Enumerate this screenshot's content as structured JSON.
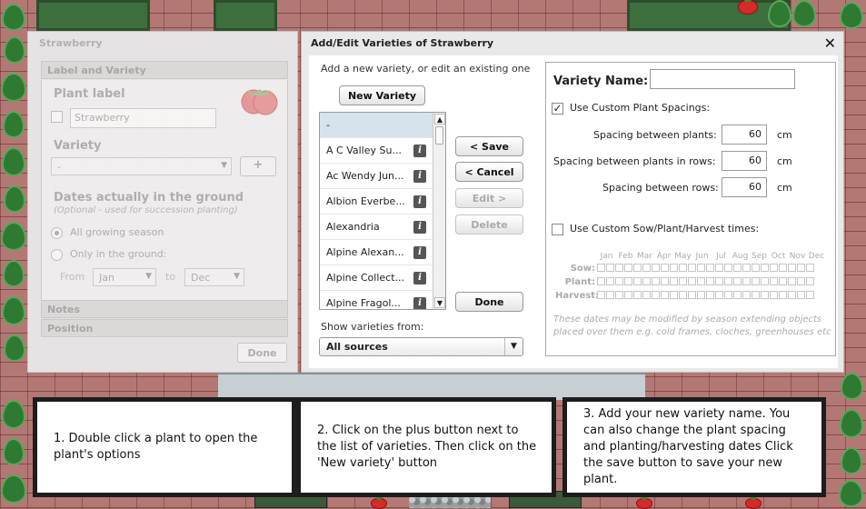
{
  "left_panel": {
    "title": "Strawberry",
    "sections": {
      "label_and_variety": "Label and Variety",
      "notes": "Notes",
      "position": "Position"
    },
    "plant_label_heading": "Plant label",
    "plant_label_value": "Strawberry",
    "variety_heading": "Variety",
    "variety_value": "-",
    "add_button": "+",
    "dates_heading": "Dates actually in the ground",
    "dates_hint": "(Optional - used for succession planting)",
    "radio_all_season": "All growing season",
    "radio_only_ground": "Only in the ground:",
    "from_label": "From",
    "from_value": "Jan",
    "to_label": "to",
    "to_value": "Dec",
    "done_button": "Done"
  },
  "dialog": {
    "title": "Add/Edit Varieties of Strawberry",
    "close_glyph": "✕",
    "hint": "Add a new variety, or edit an existing one",
    "new_variety_button": "New Variety",
    "varieties": [
      {
        "name": "-",
        "selected": true
      },
      {
        "name": "A C Valley Su..."
      },
      {
        "name": "Ac Wendy Jun..."
      },
      {
        "name": "Albion Everbe..."
      },
      {
        "name": "Alexandria"
      },
      {
        "name": "Alpine Alexan..."
      },
      {
        "name": "Alpine Collect..."
      },
      {
        "name": "Alpine Fragol..."
      }
    ],
    "info_glyph": "i",
    "buttons": {
      "save": "< Save",
      "cancel": "< Cancel",
      "edit": "Edit >",
      "delete": "Delete",
      "done": "Done"
    },
    "show_from_label": "Show varieties from:",
    "source_value": "All sources"
  },
  "form": {
    "variety_name_label": "Variety Name:",
    "variety_name_value": "",
    "custom_spacings_label": "Use Custom Plant Spacings:",
    "custom_spacings_checked": "✓",
    "spacing_plants_label": "Spacing between plants:",
    "spacing_plants_value": "60",
    "spacing_rows_plants_label": "Spacing between plants in rows:",
    "spacing_rows_plants_value": "60",
    "spacing_rows_label": "Spacing between rows:",
    "spacing_rows_value": "60",
    "unit": "cm",
    "custom_times_label": "Use Custom Sow/Plant/Harvest times:",
    "months": [
      "Jan",
      "Feb",
      "Mar",
      "Apr",
      "May",
      "Jun",
      "Jul",
      "Aug",
      "Sep",
      "Oct",
      "Nov",
      "Dec"
    ],
    "rows": [
      "Sow:",
      "Plant:",
      "Harvest:"
    ],
    "note": "These dates may be modified by season extending objects placed over them e.g. cold frames, cloches, greenhouses etc"
  },
  "instructions": [
    "1. Double click a plant to open the plant's options",
    "2. Click on the plus button next to the list of varieties. Then click on the 'New variety' button",
    "3. Add your new variety name. You can also change the plant spacing and planting/harvesting dates Click the save button to save your new plant."
  ]
}
